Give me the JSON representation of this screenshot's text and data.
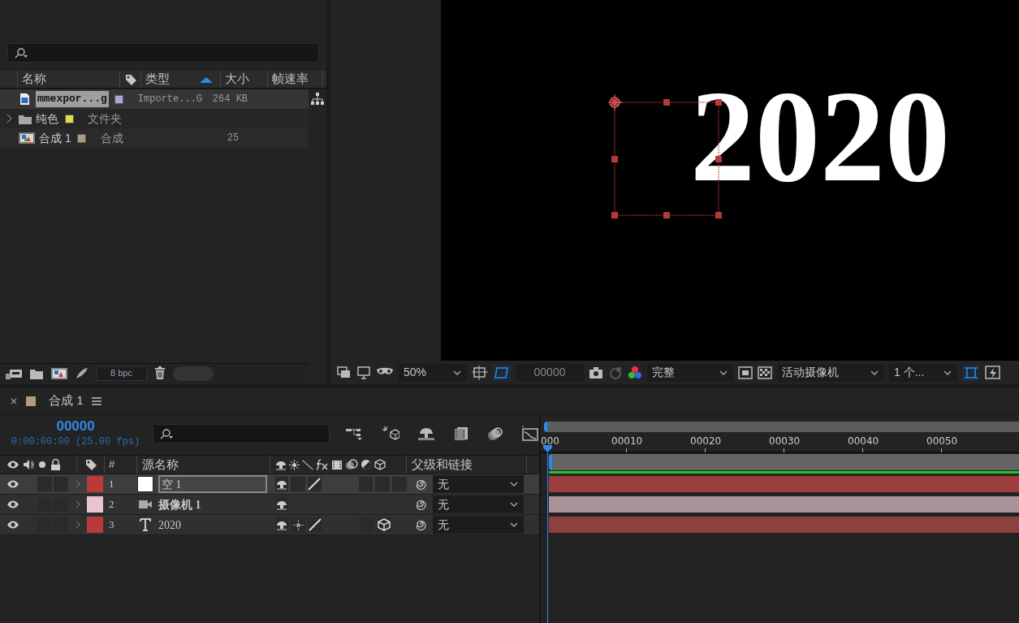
{
  "project_panel": {
    "columns": [
      {
        "label": "名称",
        "sorted": false
      },
      {
        "label": "类型",
        "sorted": true
      },
      {
        "label": "大小",
        "sorted": false
      },
      {
        "label": "帧速率",
        "sorted": false
      }
    ],
    "items": [
      {
        "kind": "image",
        "name": "mmexpor...g",
        "color": "#a9a8d0",
        "type": "Importe...G",
        "size": "264 KB",
        "selected": true
      },
      {
        "kind": "folder",
        "name": "纯色",
        "color": "#e2d94a",
        "type": "文件夹",
        "selected": false,
        "expanded": false
      },
      {
        "kind": "comp",
        "name": "合成 1",
        "color": "#b09c7b",
        "type": "合成",
        "fps": "25",
        "selected": false
      }
    ],
    "bit_depth": "8 bpc"
  },
  "viewer": {
    "text": "2020",
    "zoom": "50%",
    "timecode": "00000",
    "resolution": "完整",
    "view": "活动摄像机",
    "view_layout": "1 个..."
  },
  "timeline": {
    "tab": {
      "label": "合成 1",
      "color": "#b09c7b"
    },
    "timecode": "00000",
    "time_detail": "0:00:00:00 (25.00 fps)",
    "columns": {
      "number": "#",
      "source_name": "源名称",
      "parent": "父级和链接"
    },
    "layers": [
      {
        "kind": "null",
        "number": "1",
        "name": "空 1",
        "color": "#b83a3a",
        "visible": true,
        "selected": true,
        "quality": true,
        "three_d": false,
        "parent": "无"
      },
      {
        "kind": "camera",
        "number": "2",
        "name": "摄像机 1",
        "color": "#e9c3cd",
        "visible": true,
        "selected": false,
        "parent": "无"
      },
      {
        "kind": "text",
        "number": "3",
        "name": "2020",
        "color": "#b83a3a",
        "visible": true,
        "selected": false,
        "quality": true,
        "three_d": true,
        "parent": "无"
      }
    ],
    "ruler": [
      "000",
      "00010",
      "00020",
      "00030",
      "00040",
      "00050"
    ]
  }
}
